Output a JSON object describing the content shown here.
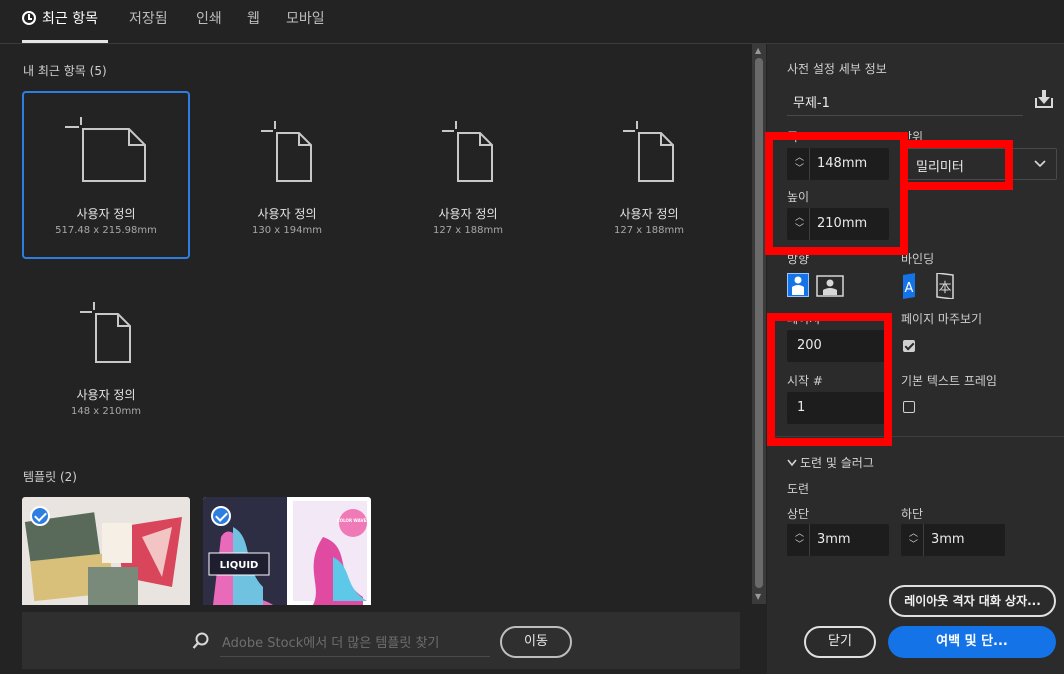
{
  "tabs": [
    {
      "label": "최근 항목"
    },
    {
      "label": "저장됨"
    },
    {
      "label": "인쇄"
    },
    {
      "label": "웹"
    },
    {
      "label": "모바일"
    }
  ],
  "recent": {
    "title": "내 최근 항목",
    "count": "(5)",
    "items": [
      {
        "name": "사용자 정의",
        "dims": "517.48 x 215.98mm"
      },
      {
        "name": "사용자 정의",
        "dims": "130 x 194mm"
      },
      {
        "name": "사용자 정의",
        "dims": "127 x 188mm"
      },
      {
        "name": "사용자 정의",
        "dims": "127 x 188mm"
      },
      {
        "name": "사용자 정의",
        "dims": "148 x 210mm"
      }
    ]
  },
  "templates": {
    "title": "템플릿",
    "count": "(2)",
    "items": [
      {
        "text": ""
      },
      {
        "text": "LIQUID"
      }
    ],
    "color_waves_text": "COLOR WAVES"
  },
  "search": {
    "placeholder": "Adobe Stock에서 더 많은 템플릿 찾기",
    "go_label": "이동"
  },
  "preset": {
    "section_title": "사전 설정 세부 정보",
    "name": "무제-1",
    "width_label": "폭",
    "width_value": "148mm",
    "units_label": "단위",
    "units_value": "밀리미터",
    "height_label": "높이",
    "height_value": "210mm",
    "orientation_label": "방향",
    "binding_label": "바인딩",
    "pages_label": "페이지",
    "pages_value": "200",
    "facing_label": "페이지 마주보기",
    "facing_checked": true,
    "start_label": "시작 #",
    "start_value": "1",
    "primary_frame_label": "기본 텍스트 프레임",
    "primary_frame_checked": false,
    "bleed_section": "도련 및 슬러그",
    "bleed_label": "도련",
    "top_label": "상단",
    "top_value": "3mm",
    "bottom_label": "하단",
    "bottom_value": "3mm"
  },
  "buttons": {
    "layout_grid": "레이아웃 격자 대화 상자...",
    "close": "닫기",
    "margins": "여백 및 단..."
  },
  "colors": {
    "accent": "#1473e6",
    "highlight": "#ff0000",
    "background": "#232323",
    "panel": "#2b2b2b"
  }
}
